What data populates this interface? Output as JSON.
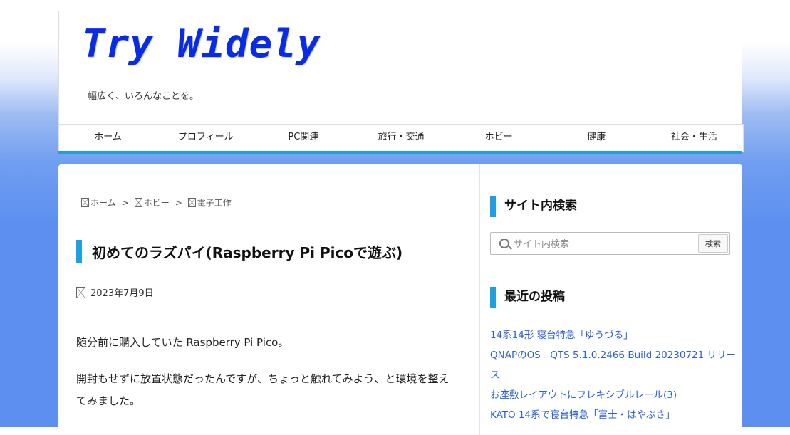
{
  "site": {
    "title": "Try Widely",
    "tagline": "幅広く、いろんなことを。"
  },
  "nav": {
    "items": [
      {
        "label": "ホーム"
      },
      {
        "label": "プロフィール"
      },
      {
        "label": "PC関連"
      },
      {
        "label": "旅行・交通"
      },
      {
        "label": "ホビー"
      },
      {
        "label": "健康"
      },
      {
        "label": "社会・生活"
      }
    ]
  },
  "breadcrumb": {
    "items": [
      {
        "label": "ホーム",
        "icon": "broken-image-icon"
      },
      {
        "label": "ホビー",
        "icon": "broken-image-icon"
      },
      {
        "label": "電子工作",
        "icon": "broken-image-icon"
      }
    ],
    "separator": ">"
  },
  "article": {
    "title": "初めてのラズパイ(Raspberry Pi Picoで遊ぶ)",
    "date": "2023年7月9日",
    "paragraphs": [
      "随分前に購入していた Raspberry Pi Pico。",
      "開封もせずに放置状態だったんですが、ちょっと触れてみよう、と環境を整えてみました。"
    ]
  },
  "sidebar": {
    "search": {
      "title": "サイト内検索",
      "placeholder": "サイト内検索",
      "button_label": "検索"
    },
    "recent": {
      "title": "最近の投稿",
      "posts": [
        "14系14形 寝台特急「ゆうづる」",
        "QNAPのOS　QTS 5.1.0.2466 Build 20230721 リリース",
        "お座敷レイアウトにフレキシブルレール(3)",
        "KATO 14系で寝台特急「富士・はやぶさ」"
      ]
    }
  },
  "colors": {
    "accent": "#1ea0e0",
    "title": "#0a2be6",
    "link": "#2a5fd6",
    "background": "#5c8ff0"
  }
}
